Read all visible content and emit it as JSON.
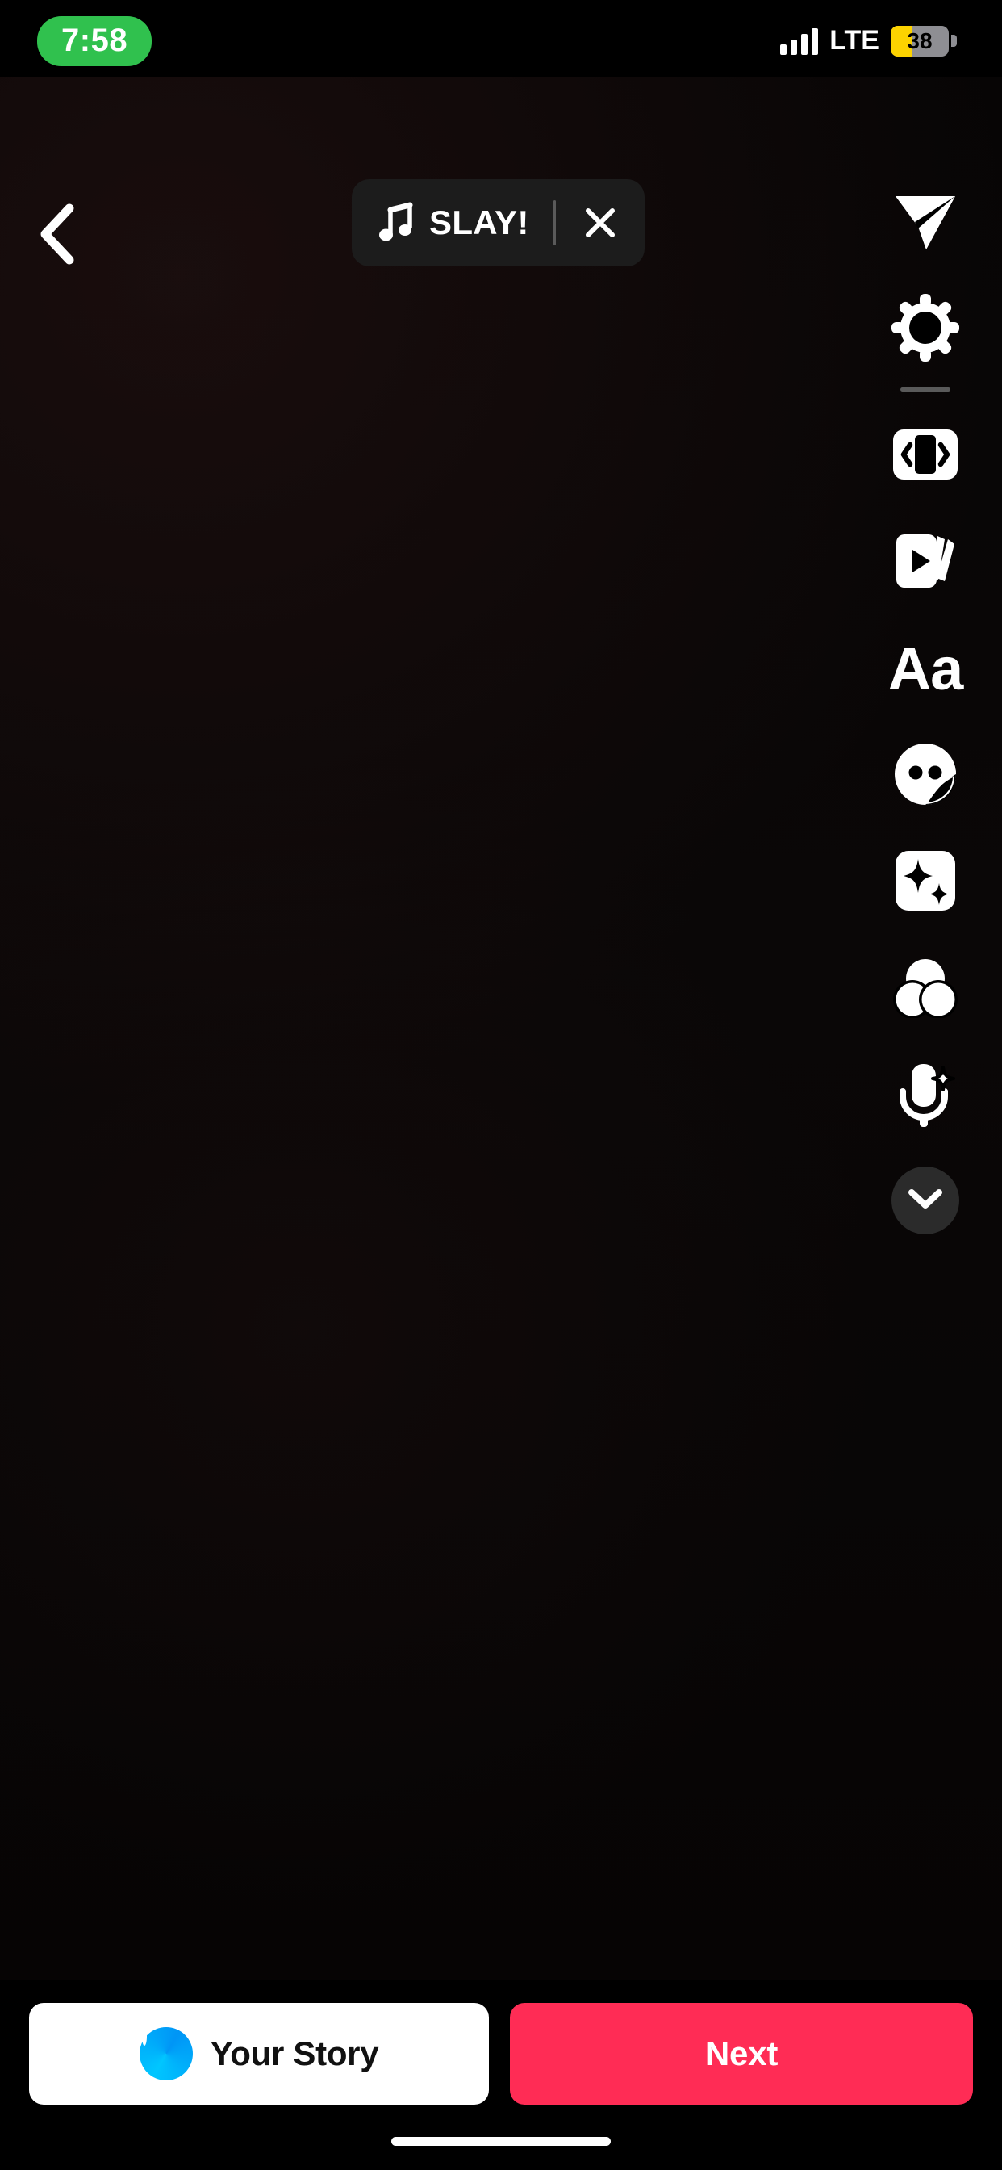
{
  "status_bar": {
    "time": "7:58",
    "time_pill_color": "#30C14E",
    "network": "LTE",
    "signal_icon": "signal-bars-icon",
    "battery_level": "38",
    "battery_fill_color": "#FCD300",
    "battery_body_color": "#8E8E93"
  },
  "top_controls": {
    "back_icon": "chevron-left-icon",
    "music": {
      "note_icon": "music-note-icon",
      "title": "SLAY!",
      "close_icon": "close-x-icon"
    }
  },
  "toolbar": {
    "items": [
      {
        "name": "share-send",
        "icon": "paper-plane-icon",
        "label": "Send"
      },
      {
        "name": "settings",
        "icon": "gear-icon",
        "label": "Settings"
      },
      {
        "name": "boomerang",
        "icon": "boomerang-icon",
        "label": "Boomerang"
      },
      {
        "name": "layout",
        "icon": "layout-cards-icon",
        "label": "Layout"
      },
      {
        "name": "text",
        "icon": "text-aa-icon",
        "label": "Aa"
      },
      {
        "name": "sticker",
        "icon": "sticker-face-icon",
        "label": "Stickers"
      },
      {
        "name": "effects",
        "icon": "sparkles-icon",
        "label": "Effects"
      },
      {
        "name": "filters",
        "icon": "three-circles-icon",
        "label": "Filters"
      },
      {
        "name": "voice-effects",
        "icon": "microphone-sparkle-icon",
        "label": "Voice"
      }
    ],
    "text_tool_label": "Aa",
    "collapse_icon": "chevron-down-icon"
  },
  "bottom_bar": {
    "your_story_label": "Your Story",
    "your_story_avatar": "user-avatar",
    "next_label": "Next",
    "next_color": "#FF2C55",
    "your_story_color": "#FFFFFF"
  },
  "home_indicator": "home-indicator-bar"
}
